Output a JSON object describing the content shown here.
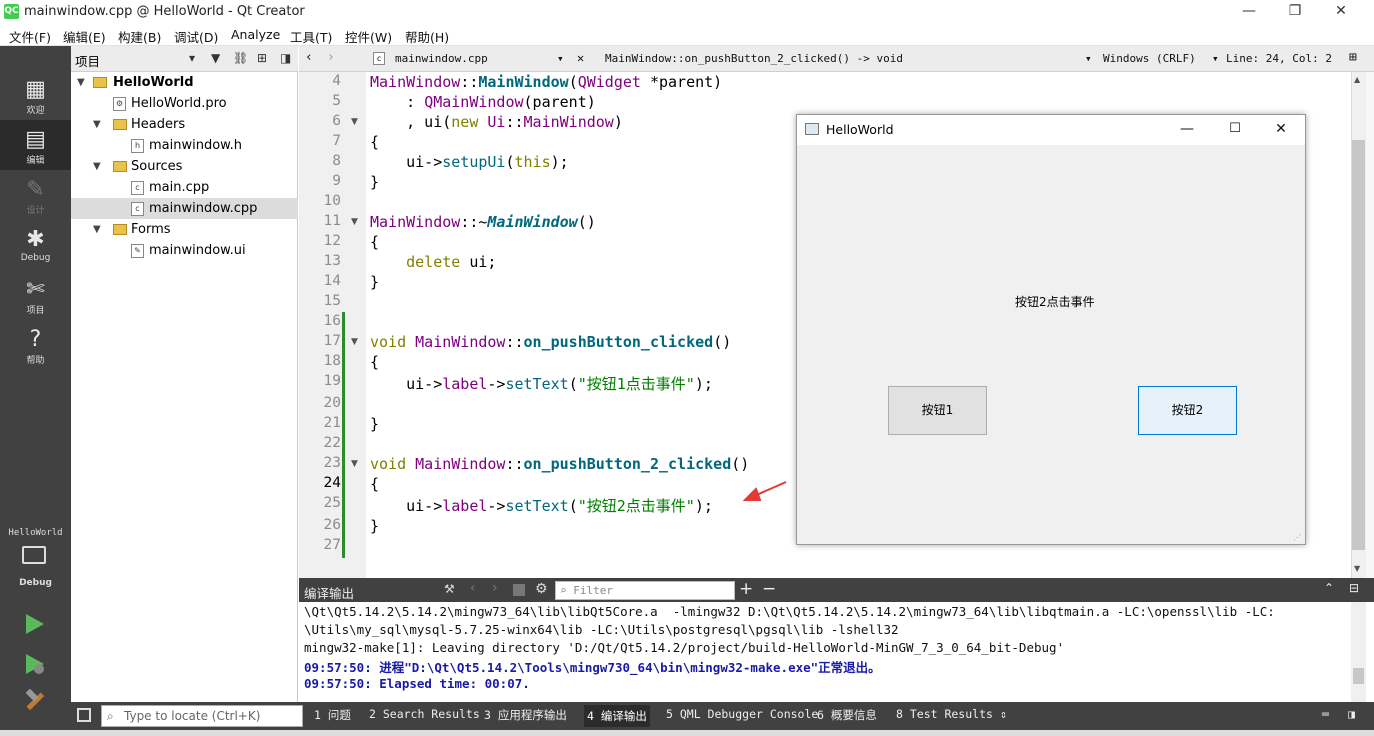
{
  "window": {
    "title": "mainwindow.cpp @ HelloWorld - Qt Creator",
    "logo": "QC",
    "controls": [
      "—",
      "❐",
      "✕"
    ]
  },
  "menu": [
    "文件(F)",
    "编辑(E)",
    "构建(B)",
    "调试(D)",
    "Analyze",
    "工具(T)",
    "控件(W)",
    "帮助(H)"
  ],
  "modes": [
    {
      "icon": "grid-icon",
      "glyph": "▦",
      "label": "欢迎"
    },
    {
      "icon": "edit-icon",
      "glyph": "▤",
      "label": "编辑"
    },
    {
      "icon": "design-icon",
      "glyph": "✎",
      "label": "设计"
    },
    {
      "icon": "bug-icon",
      "glyph": "✱",
      "label": "Debug"
    },
    {
      "icon": "wrench-icon",
      "glyph": "✄",
      "label": "项目"
    },
    {
      "icon": "help-icon",
      "glyph": "?",
      "label": "帮助"
    }
  ],
  "kit": {
    "project": "HelloWorld",
    "label": "Debug"
  },
  "project_pane": {
    "title": "项目",
    "tree": [
      {
        "label": "HelloWorld",
        "bold": true
      },
      {
        "label": "HelloWorld.pro"
      },
      {
        "label": "Headers"
      },
      {
        "label": "mainwindow.h"
      },
      {
        "label": "Sources"
      },
      {
        "label": "main.cpp"
      },
      {
        "label": "mainwindow.cpp",
        "selected": true
      },
      {
        "label": "Forms"
      },
      {
        "label": "mainwindow.ui"
      }
    ]
  },
  "editor_toolbar": {
    "file": "mainwindow.cpp",
    "function": "MainWindow::on_pushButton_2_clicked() -> void",
    "encoding": "Windows (CRLF)",
    "position": "Line: 24, Col: 2"
  },
  "editor": {
    "current_line": 24,
    "line_numbers": [
      "4",
      "5",
      "6",
      "7",
      "8",
      "9",
      "10",
      "11",
      "12",
      "13",
      "14",
      "15",
      "16",
      "17",
      "18",
      "19",
      "20",
      "21",
      "22",
      "23",
      "24",
      "25",
      "26",
      "27"
    ]
  },
  "app_window": {
    "title": "HelloWorld",
    "label": "按钮2点击事件",
    "button1": "按钮1",
    "button2": "按钮2"
  },
  "output": {
    "title": "编译输出",
    "filter_placeholder": "Filter",
    "lines": [
      "\\Qt\\Qt5.14.2\\5.14.2\\mingw73_64\\lib\\libQt5Core.a  -lmingw32 D:\\Qt\\Qt5.14.2\\5.14.2\\mingw73_64\\lib\\libqtmain.a -LC:\\openssl\\lib -LC:",
      "\\Utils\\my_sql\\mysql-5.7.25-winx64\\lib -LC:\\Utils\\postgresql\\pgsql\\lib -lshell32",
      "mingw32-make[1]: Leaving directory 'D:/Qt/Qt5.14.2/project/build-HelloWorld-MinGW_7_3_0_64_bit-Debug'",
      "09:57:50: 进程\"D:\\Qt\\Qt5.14.2\\Tools\\mingw730_64\\bin\\mingw32-make.exe\"正常退出。",
      "09:57:50: Elapsed time: 00:07."
    ]
  },
  "statusbar": {
    "locate_placeholder": "Type to locate (Ctrl+K)",
    "tabs": [
      "1 问题",
      "2 Search Results",
      "3 应用程序输出",
      "4 编译输出",
      "5 QML Debugger Console",
      "6 概要信息",
      "8 Test Results"
    ],
    "active_tab": "4 编译输出"
  },
  "colors": {
    "mode_bar": "#414141",
    "accent_green": "#41cd52",
    "annotation_arrow": "#e53935"
  }
}
